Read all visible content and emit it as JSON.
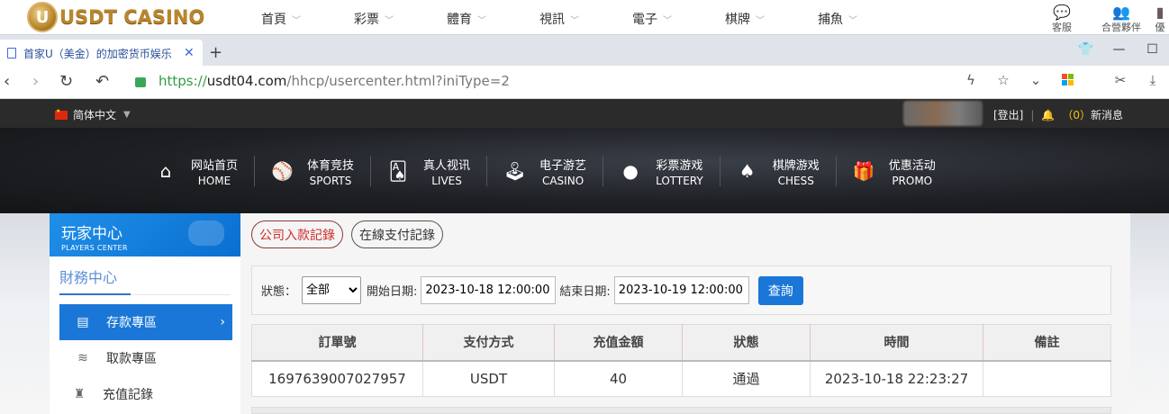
{
  "site_header": {
    "logo_letter": "U",
    "logo_text": "USDT CASINO",
    "menu": [
      {
        "label": "首頁"
      },
      {
        "label": "彩票"
      },
      {
        "label": "體育"
      },
      {
        "label": "視訊"
      },
      {
        "label": "電子"
      },
      {
        "label": "棋牌"
      },
      {
        "label": "捕魚"
      }
    ],
    "right_items": [
      {
        "label": "客服"
      },
      {
        "label": "合營夥伴"
      },
      {
        "label": "優"
      }
    ]
  },
  "browser": {
    "tab_title": "首家U（美金）的加密货币娱乐",
    "url_scheme": "https://",
    "url_host": "usdt04.com",
    "url_path": "/hhcp/usercenter.html?iniType=2"
  },
  "userbar": {
    "language": "简体中文",
    "logout": "[登出]",
    "message_count": "（0）",
    "message_label": "新消息"
  },
  "main_nav": [
    {
      "cn": "网站首页",
      "en": "HOME",
      "icon": "home-icon"
    },
    {
      "cn": "体育竞技",
      "en": "SPORTS",
      "icon": "ball-icon"
    },
    {
      "cn": "真人视讯",
      "en": "LIVES",
      "icon": "cards-icon"
    },
    {
      "cn": "电子游艺",
      "en": "CASINO",
      "icon": "joystick-icon"
    },
    {
      "cn": "彩票游戏",
      "en": "LOTTERY",
      "icon": "lottery-balls-icon"
    },
    {
      "cn": "棋牌游戏",
      "en": "CHESS",
      "icon": "spade-icon"
    },
    {
      "cn": "优惠活动",
      "en": "PROMO",
      "icon": "gift-icon"
    }
  ],
  "sidebar": {
    "title_cn": "玩家中心",
    "title_en": "PLAYERS CENTER",
    "section": "財務中心",
    "items": [
      {
        "label": "存款專區",
        "icon": "card-icon"
      },
      {
        "label": "取款專區",
        "icon": "cash-icon"
      },
      {
        "label": "充值記錄",
        "icon": "bag-icon"
      }
    ]
  },
  "panel": {
    "tabs": [
      "公司入款記錄",
      "在線支付記錄"
    ],
    "filter": {
      "status_label": "狀態：",
      "status_value": "全部",
      "start_label": "開始日期:",
      "start_value": "2023-10-18 12:00:00",
      "end_label": "結束日期:",
      "end_value": "2023-10-19 12:00:00",
      "query_label": "查詢"
    },
    "table": {
      "headers": [
        "訂單號",
        "支付方式",
        "充值金額",
        "狀態",
        "時間",
        "備註"
      ],
      "rows": [
        [
          "1697639007027957",
          "USDT",
          "40",
          "通過",
          "2023-10-18 22:23:27",
          ""
        ]
      ]
    }
  },
  "colors": {
    "accent": "#1a77d7",
    "active_tab_text": "#d12b2b",
    "logo_gold": "#b8862d"
  }
}
